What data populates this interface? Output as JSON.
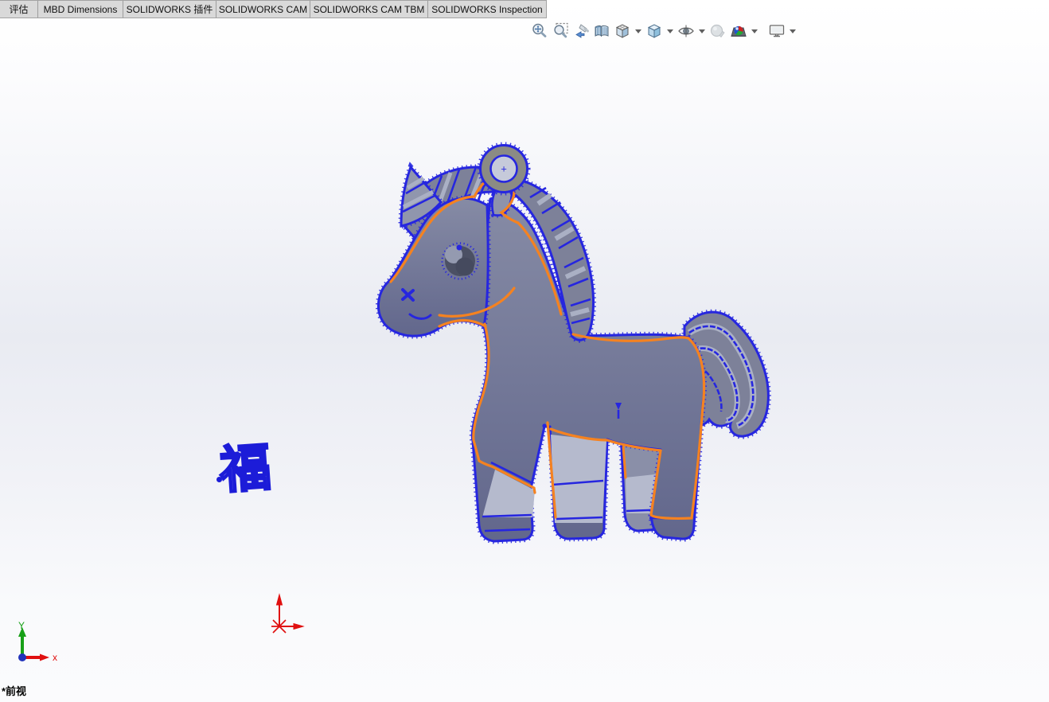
{
  "tabs": [
    {
      "label": "评估"
    },
    {
      "label": "MBD Dimensions"
    },
    {
      "label": "SOLIDWORKS 插件"
    },
    {
      "label": "SOLIDWORKS CAM"
    },
    {
      "label": "SOLIDWORKS CAM TBM"
    },
    {
      "label": "SOLIDWORKS Inspection"
    }
  ],
  "toolbar": {
    "icons": [
      {
        "name": "zoom-to-fit"
      },
      {
        "name": "zoom-to-area"
      },
      {
        "name": "previous-view"
      },
      {
        "name": "section-view"
      },
      {
        "name": "view-orientation",
        "dropdown": true
      },
      {
        "name": "display-style",
        "dropdown": true
      },
      {
        "name": "hide-show-items",
        "dropdown": true
      },
      {
        "name": "edit-appearance",
        "dropdown": false
      },
      {
        "name": "apply-scene",
        "dropdown": true
      },
      {
        "name": "view-settings",
        "dropdown": true
      }
    ]
  },
  "viewport": {
    "view_label": "*前视",
    "sketch_character": "福",
    "ring_plus": "+",
    "triad": {
      "x_label": "x",
      "y_label": "Y"
    },
    "colors": {
      "sketch_blue": "#2626df",
      "contour_orange": "#f58220",
      "body_fill": "#6e7394",
      "body_light": "#b5bacd",
      "mane_fill": "#7d8199",
      "ring_gray": "#8b8b84",
      "ring_inner": "#c6cada",
      "origin_red": "#e01010",
      "triad_green": "#18a018"
    }
  }
}
